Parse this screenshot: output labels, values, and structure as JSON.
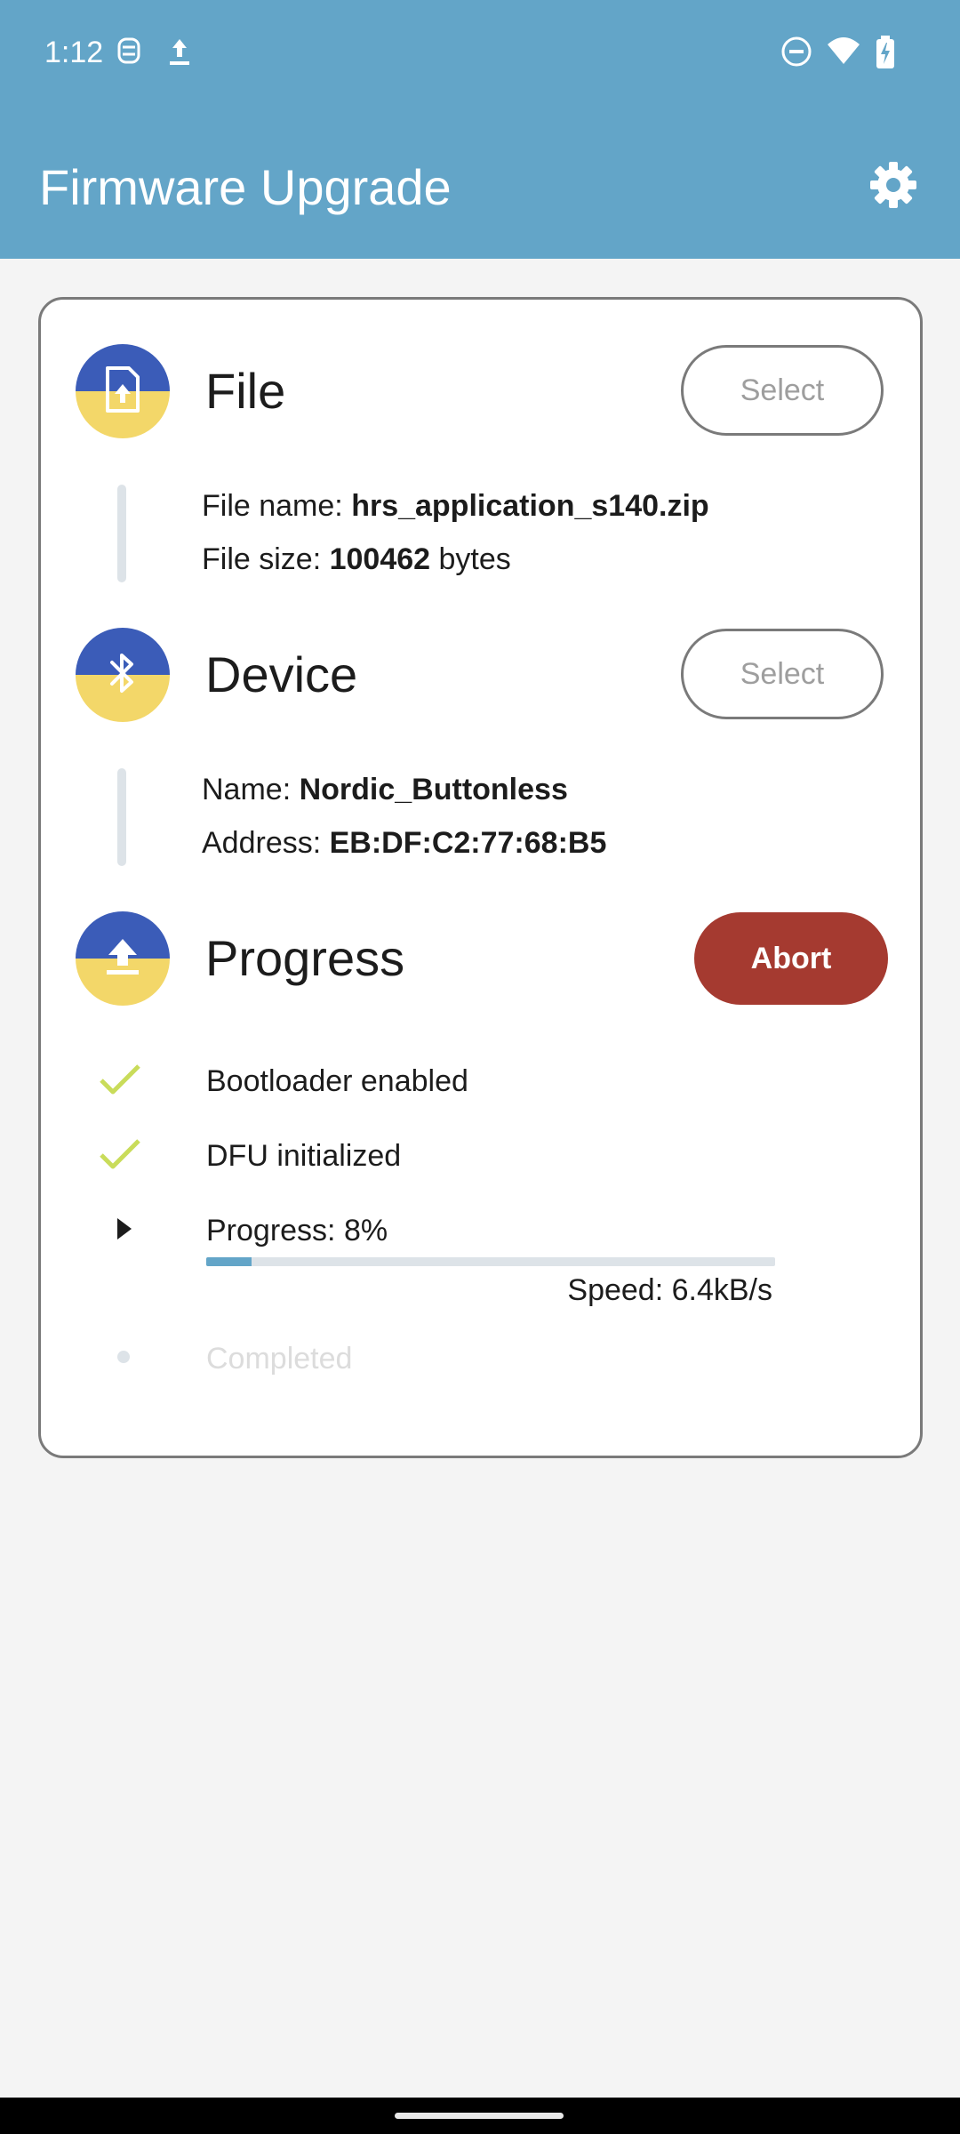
{
  "status_bar": {
    "time": "1:12",
    "icons_left": [
      "notification-robot-icon",
      "upload-icon"
    ],
    "icons_right": [
      "do-not-disturb-icon",
      "wifi-icon",
      "battery-charging-icon"
    ]
  },
  "app_bar": {
    "title": "Firmware Upgrade",
    "settings_icon": "gear-icon"
  },
  "file_section": {
    "title": "File",
    "select_label": "Select",
    "name_label": "File name: ",
    "name_value": "hrs_application_s140.zip",
    "size_label": "File size: ",
    "size_value": "100462",
    "size_unit": " bytes"
  },
  "device_section": {
    "title": "Device",
    "select_label": "Select",
    "name_label": "Name: ",
    "name_value": "Nordic_Buttonless",
    "address_label": "Address: ",
    "address_value": "EB:DF:C2:77:68:B5"
  },
  "progress_section": {
    "title": "Progress",
    "abort_label": "Abort",
    "steps": [
      {
        "label": "Bootloader enabled",
        "state": "done"
      },
      {
        "label": "DFU initialized",
        "state": "done"
      },
      {
        "label": "Progress: 8%",
        "state": "active"
      },
      {
        "label": "Completed",
        "state": "pending"
      }
    ],
    "progress_percent": 8,
    "speed": "Speed: 6.4kB/s"
  },
  "colors": {
    "app_bar": "#63a5c8",
    "icon_top": "#3b5cb8",
    "icon_bottom": "#f3d769",
    "abort": "#a53a30",
    "check": "#c9dc5a"
  }
}
